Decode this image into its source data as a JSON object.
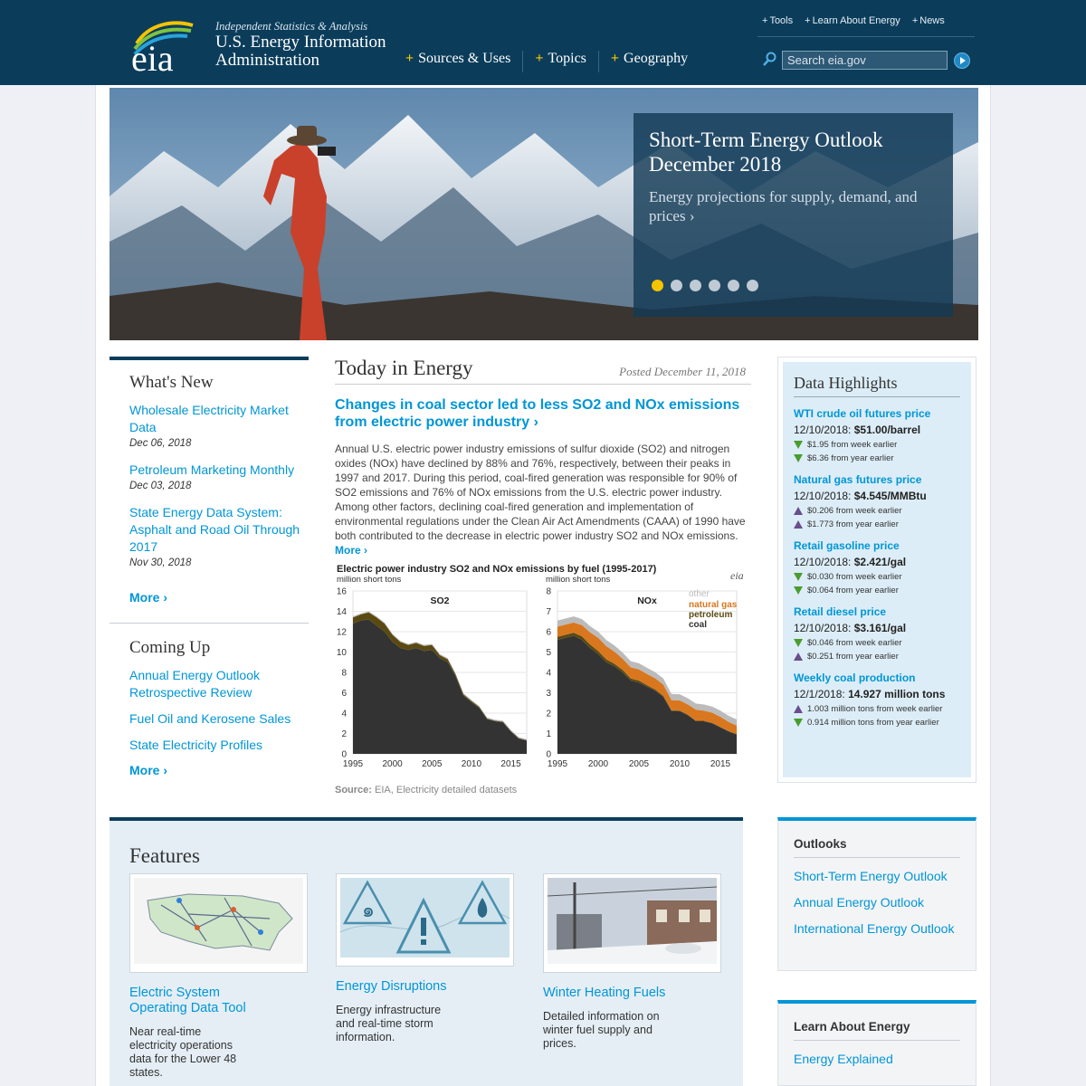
{
  "header": {
    "tagline": "Independent Statistics & Analysis",
    "org_line1": "U.S. Energy Information",
    "org_line2": "Administration",
    "top_links": [
      "Tools",
      "Learn About Energy",
      "News"
    ],
    "nav": [
      "Sources & Uses",
      "Topics",
      "Geography"
    ],
    "search_placeholder": "Search eia.gov"
  },
  "hero": {
    "title_line1": "Short-Term Energy Outlook",
    "title_line2": "December 2018",
    "description": "Energy projections for supply, demand, and prices ›",
    "slide_count": 6,
    "active_slide": 1
  },
  "whats_new": {
    "heading": "What's New",
    "items": [
      {
        "title": "Wholesale Electricity Market Data",
        "date": "Dec 06, 2018"
      },
      {
        "title": "Petroleum Marketing Monthly",
        "date": "Dec 03, 2018"
      },
      {
        "title": "State Energy Data System: Asphalt and Road Oil Through 2017",
        "date": "Nov 30, 2018"
      }
    ],
    "more": "More ›"
  },
  "coming_up": {
    "heading": "Coming Up",
    "items": [
      "Annual Energy Outlook Retrospective Review",
      "Fuel Oil and Kerosene Sales",
      "State Electricity Profiles"
    ],
    "more": "More ›"
  },
  "today_in_energy": {
    "heading": "Today in Energy",
    "posted": "Posted December 11, 2018",
    "title": "Changes in coal sector led to less SO2 and NOx emissions from electric power industry ›",
    "body": "Annual U.S. electric power industry emissions of sulfur dioxide (SO2) and nitrogen oxides (NOx) have declined by 88% and 76%, respectively, between their peaks in 1997 and 2017. During this period, coal-fired generation was responsible for 90% of SO2 emissions and 76% of NOx emissions from the U.S. electric power industry. Among other factors, declining coal-fired generation and implementation of environmental regulations under the Clean Air Act Amendments (CAAA) of 1990 have both contributed to the decrease in electric power industry SO2 and NOx emissions.",
    "more": "More ›",
    "source_label": "Source:",
    "source_text": "EIA, Electricity detailed datasets"
  },
  "chart_data": {
    "type": "area",
    "title": "Electric power industry SO2 and NOx emissions by fuel (1995-2017)",
    "ylabel": "million short tons",
    "logo": "eia",
    "legend": [
      "other",
      "natural gas",
      "petroleum",
      "coal"
    ],
    "legend_colors": [
      "#bbbbbb",
      "#d9771e",
      "#5a4a12",
      "#333333"
    ],
    "x": [
      1995,
      1996,
      1997,
      1998,
      1999,
      2000,
      2001,
      2002,
      2003,
      2004,
      2005,
      2006,
      2007,
      2008,
      2009,
      2010,
      2011,
      2012,
      2013,
      2014,
      2015,
      2016,
      2017
    ],
    "xticks": [
      1995,
      2000,
      2005,
      2010,
      2015
    ],
    "panels": [
      {
        "name": "SO2",
        "ylim": [
          0,
          16
        ],
        "yticks": [
          0,
          2,
          4,
          6,
          8,
          10,
          12,
          14,
          16
        ],
        "series": [
          {
            "name": "coal",
            "values": [
              12.8,
              13.1,
              13.2,
              12.6,
              12.0,
              11.0,
              10.4,
              10.2,
              10.4,
              10.1,
              10.2,
              9.4,
              9.0,
              7.6,
              5.7,
              5.1,
              4.5,
              3.4,
              3.2,
              3.1,
              2.2,
              1.5,
              1.3
            ]
          },
          {
            "name": "petroleum",
            "values": [
              0.6,
              0.6,
              0.7,
              0.8,
              0.8,
              0.7,
              0.6,
              0.5,
              0.5,
              0.5,
              0.5,
              0.3,
              0.3,
              0.2,
              0.15,
              0.1,
              0.1,
              0.07,
              0.06,
              0.06,
              0.05,
              0.04,
              0.04
            ]
          },
          {
            "name": "natural gas",
            "values": [
              0.0,
              0.0,
              0.0,
              0.0,
              0.0,
              0.0,
              0.0,
              0.0,
              0.0,
              0.0,
              0.0,
              0.0,
              0.0,
              0.0,
              0.0,
              0.0,
              0.0,
              0.0,
              0.0,
              0.0,
              0.0,
              0.0,
              0.0
            ]
          },
          {
            "name": "other",
            "values": [
              0.1,
              0.1,
              0.1,
              0.1,
              0.1,
              0.1,
              0.1,
              0.1,
              0.1,
              0.1,
              0.1,
              0.1,
              0.1,
              0.1,
              0.1,
              0.1,
              0.1,
              0.1,
              0.1,
              0.1,
              0.1,
              0.1,
              0.1
            ]
          }
        ]
      },
      {
        "name": "NOx",
        "ylim": [
          0,
          8
        ],
        "yticks": [
          0,
          1,
          2,
          3,
          4,
          5,
          6,
          7,
          8
        ],
        "series": [
          {
            "name": "coal",
            "values": [
              5.6,
              5.7,
              5.8,
              5.6,
              5.2,
              4.9,
              4.5,
              4.3,
              4.0,
              3.6,
              3.5,
              3.3,
              3.1,
              2.8,
              2.1,
              2.1,
              1.9,
              1.6,
              1.6,
              1.5,
              1.3,
              1.1,
              0.95
            ]
          },
          {
            "name": "petroleum",
            "values": [
              0.15,
              0.15,
              0.15,
              0.17,
              0.17,
              0.15,
              0.14,
              0.12,
              0.12,
              0.1,
              0.1,
              0.07,
              0.06,
              0.05,
              0.04,
              0.03,
              0.03,
              0.02,
              0.02,
              0.02,
              0.02,
              0.02,
              0.02
            ]
          },
          {
            "name": "natural gas",
            "values": [
              0.5,
              0.5,
              0.5,
              0.55,
              0.6,
              0.65,
              0.65,
              0.6,
              0.55,
              0.55,
              0.55,
              0.55,
              0.55,
              0.55,
              0.5,
              0.5,
              0.5,
              0.55,
              0.5,
              0.5,
              0.5,
              0.45,
              0.42
            ]
          },
          {
            "name": "other",
            "values": [
              0.3,
              0.3,
              0.3,
              0.3,
              0.3,
              0.3,
              0.3,
              0.3,
              0.3,
              0.3,
              0.3,
              0.3,
              0.3,
              0.3,
              0.3,
              0.3,
              0.3,
              0.3,
              0.3,
              0.3,
              0.3,
              0.3,
              0.3
            ]
          }
        ]
      }
    ]
  },
  "data_highlights": {
    "heading": "Data Highlights",
    "items": [
      {
        "name": "WTI crude oil futures price",
        "date": "12/10/2018:",
        "value": "$51.00/barrel",
        "changes": [
          {
            "dir": "down",
            "text": "$1.95 from week earlier"
          },
          {
            "dir": "down",
            "text": "$6.36 from year earlier"
          }
        ]
      },
      {
        "name": "Natural gas futures price",
        "date": "12/10/2018:",
        "value": "$4.545/MMBtu",
        "changes": [
          {
            "dir": "up",
            "text": "$0.206 from week earlier"
          },
          {
            "dir": "up",
            "text": "$1.773 from year earlier"
          }
        ]
      },
      {
        "name": "Retail gasoline price",
        "date": "12/10/2018:",
        "value": "$2.421/gal",
        "changes": [
          {
            "dir": "down",
            "text": "$0.030 from week earlier"
          },
          {
            "dir": "down",
            "text": "$0.064 from year earlier"
          }
        ]
      },
      {
        "name": "Retail diesel price",
        "date": "12/10/2018:",
        "value": "$3.161/gal",
        "changes": [
          {
            "dir": "down",
            "text": "$0.046 from week earlier"
          },
          {
            "dir": "up",
            "text": "$0.251 from year earlier"
          }
        ]
      },
      {
        "name": "Weekly coal production",
        "date": "12/1/2018:",
        "value": "14.927 million tons",
        "changes": [
          {
            "dir": "up",
            "text": "1.003 million tons from week earlier"
          },
          {
            "dir": "down",
            "text": "0.914 million tons from year earlier"
          }
        ]
      }
    ]
  },
  "features": {
    "heading": "Features",
    "items": [
      {
        "title": "Electric System Operating Data Tool",
        "desc": "Near real-time electricity operations data for the Lower 48 states."
      },
      {
        "title": "Energy Disruptions",
        "desc": "Energy infrastructure and real-time storm information."
      },
      {
        "title": "Winter Heating Fuels",
        "desc": "Detailed information on winter fuel supply and prices."
      }
    ]
  },
  "outlooks": {
    "heading": "Outlooks",
    "items": [
      "Short-Term Energy Outlook",
      "Annual Energy Outlook",
      "International Energy Outlook"
    ]
  },
  "learn": {
    "heading": "Learn About Energy",
    "items": [
      "Energy Explained"
    ]
  },
  "colors": {
    "header_bg": "#0b3d5b",
    "link": "#0096d6",
    "accent_yellow": "#f5c400",
    "highlights_bg": "#dcedf7"
  }
}
